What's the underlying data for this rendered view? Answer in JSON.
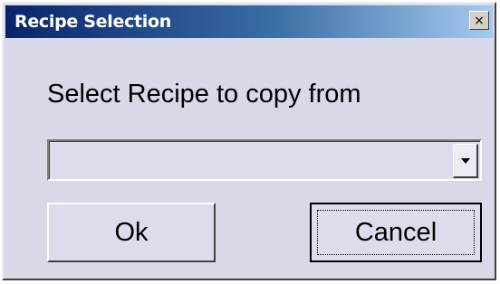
{
  "window": {
    "title": "Recipe Selection",
    "close_symbol": "×"
  },
  "prompt": {
    "label": "Select Recipe to copy from"
  },
  "recipe_select": {
    "selected_value": ""
  },
  "buttons": {
    "ok_label": "Ok",
    "cancel_label": "Cancel"
  },
  "icons": {
    "close": "close-icon",
    "dropdown": "chevron-down-icon"
  },
  "colors": {
    "title_gradient_start": "#0a246a",
    "title_gradient_end": "#a6caf0",
    "dialog_background": "#d8d8e8"
  }
}
